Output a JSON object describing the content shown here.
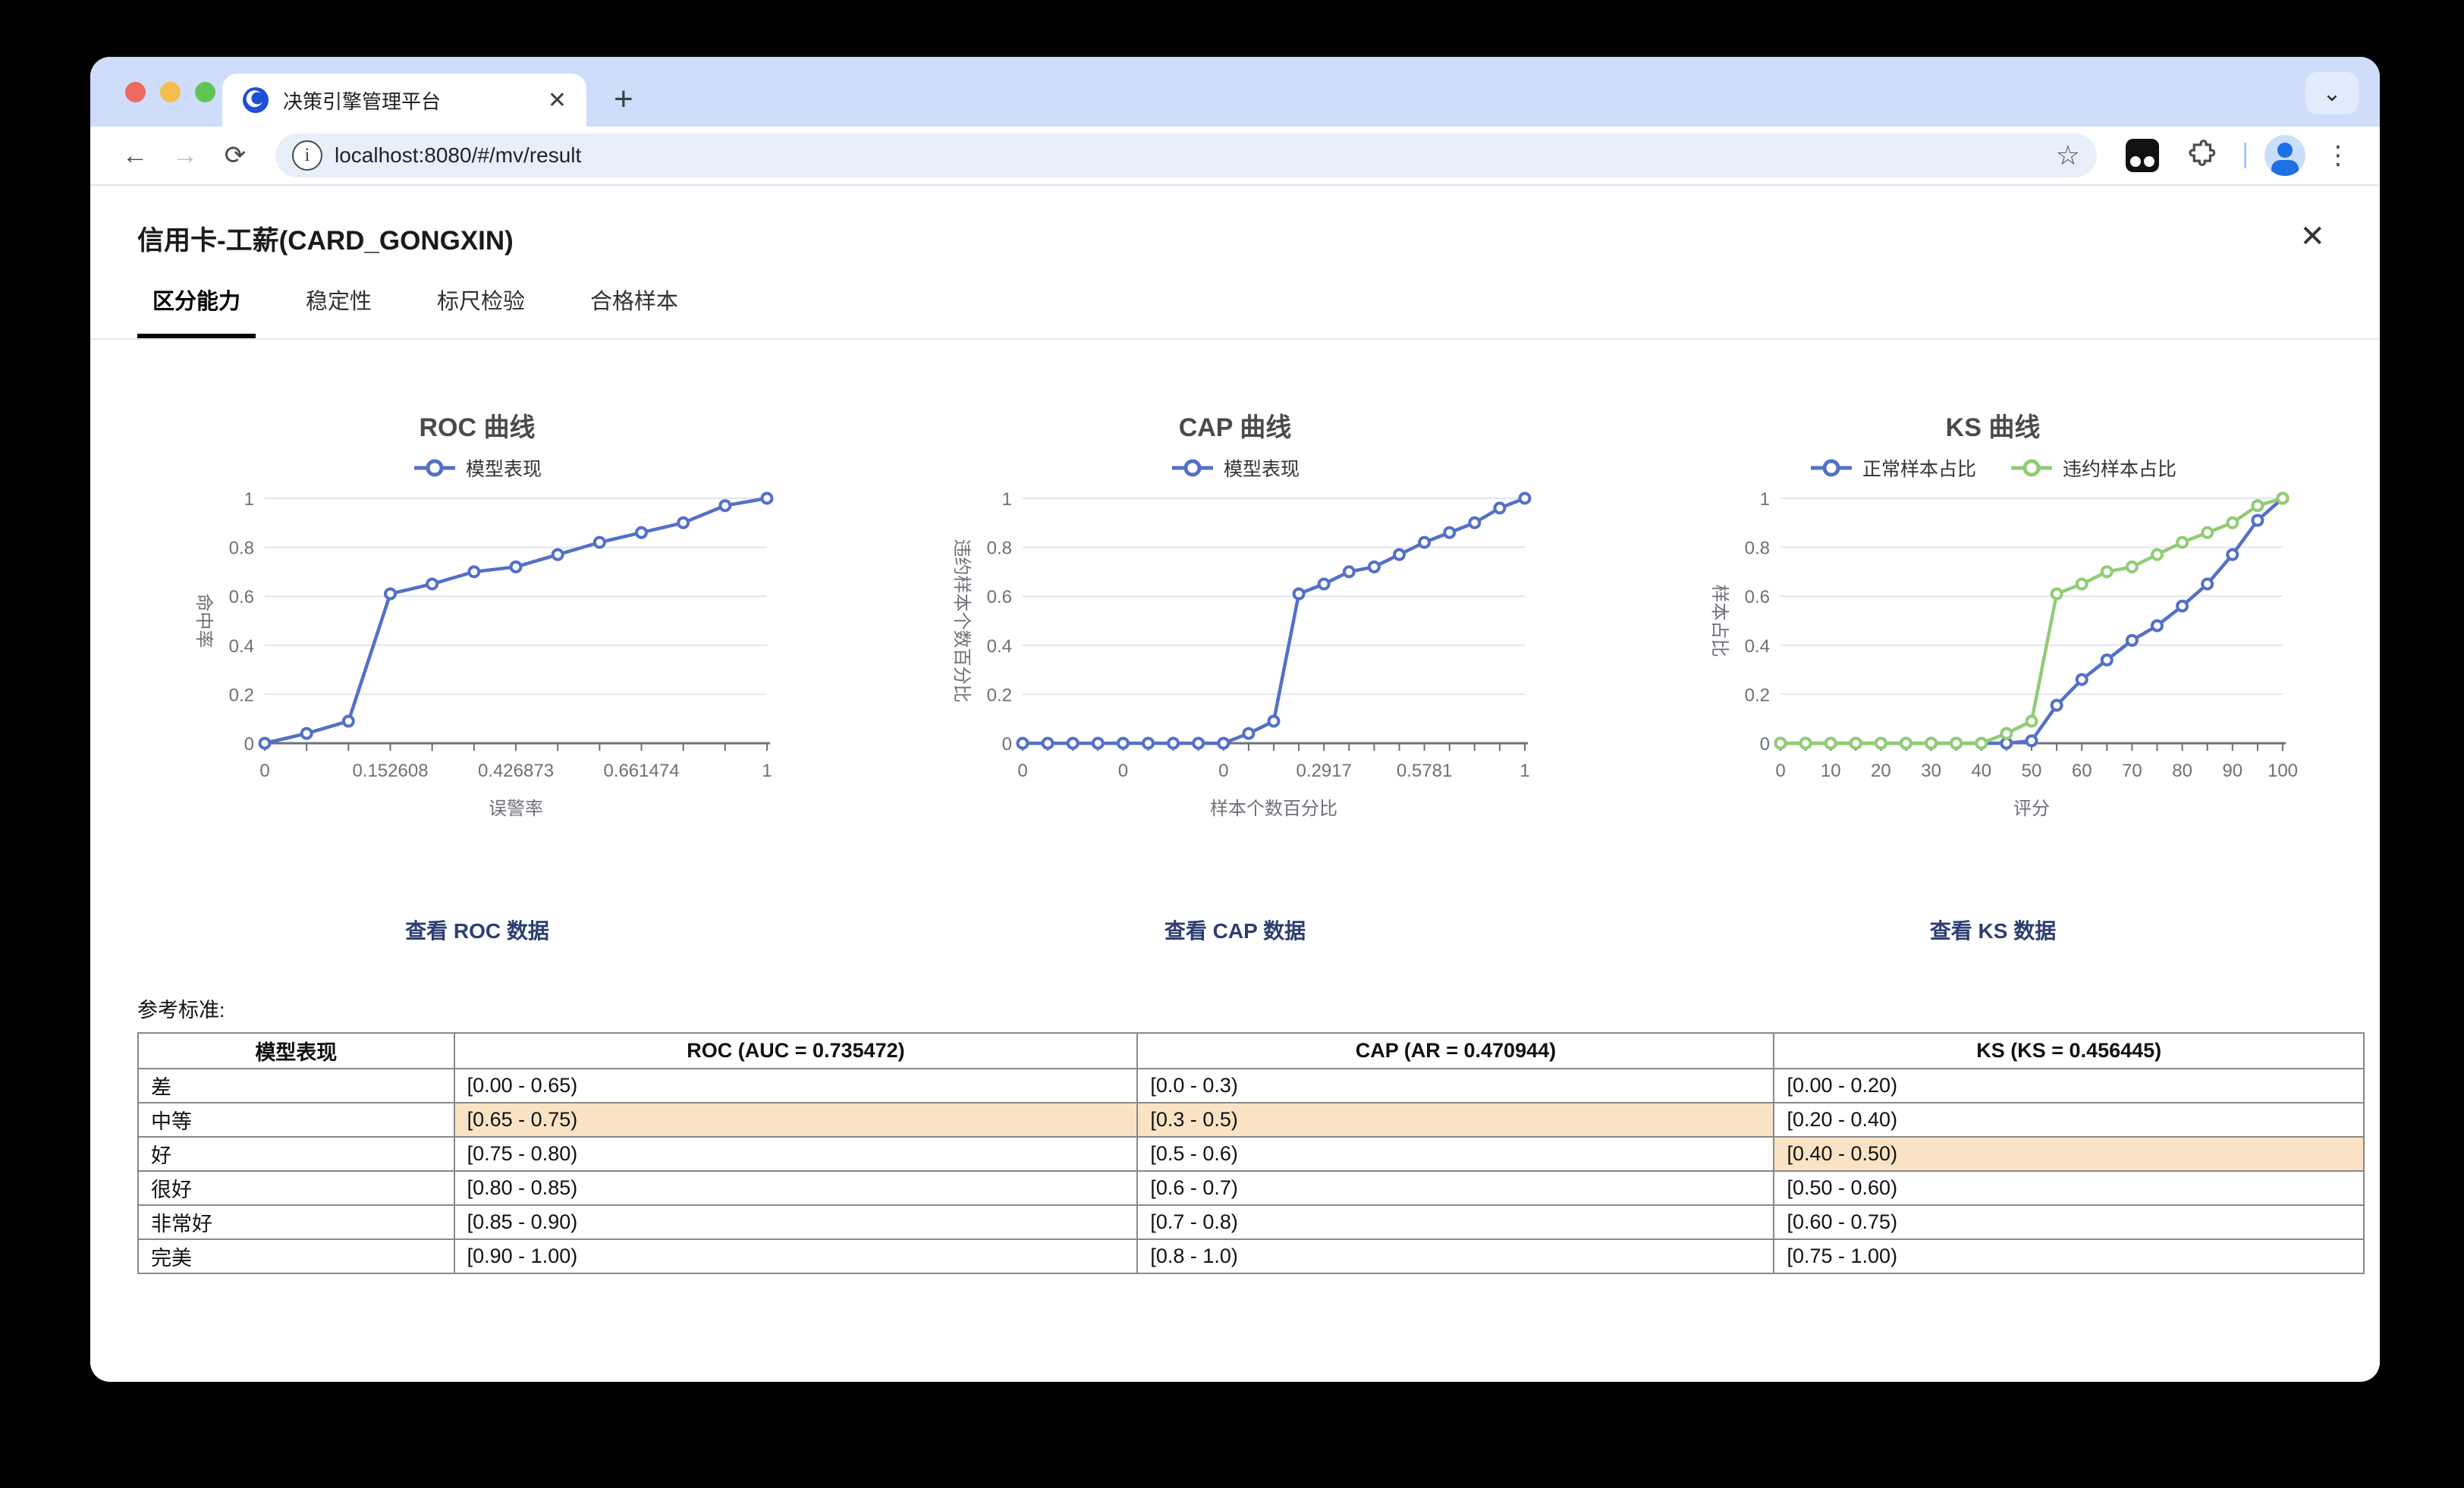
{
  "browser": {
    "tab_title": "决策引擎管理平台",
    "tab_close_icon": "✕",
    "new_tab_icon": "+",
    "strip_chevron_icon": "⌄",
    "back_icon": "←",
    "forward_icon": "→",
    "reload_icon": "⟳",
    "info_icon": "i",
    "url": "localhost:8080/#/mv/result",
    "star_icon": "☆",
    "kebab_icon": "⋮"
  },
  "page": {
    "title": "信用卡-工薪(CARD_GONGXIN)",
    "close_icon": "✕",
    "tabs": [
      {
        "label": "区分能力",
        "active": true
      },
      {
        "label": "稳定性",
        "active": false
      },
      {
        "label": "标尺检验",
        "active": false
      },
      {
        "label": "合格样本",
        "active": false
      }
    ],
    "links": [
      "查看 ROC 数据",
      "查看 CAP 数据",
      "查看 KS 数据"
    ],
    "reference_label": "参考标准:",
    "table": {
      "headers": [
        "模型表现",
        "ROC (AUC = 0.735472)",
        "CAP (AR = 0.470944)",
        "KS (KS = 0.456445)"
      ],
      "rows": [
        {
          "label": "差",
          "roc": "[0.00 - 0.65)",
          "cap": "[0.0 - 0.3)",
          "ks": "[0.00 - 0.20)",
          "highlight": []
        },
        {
          "label": "中等",
          "roc": "[0.65 - 0.75)",
          "cap": "[0.3 - 0.5)",
          "ks": "[0.20 - 0.40)",
          "highlight": [
            "roc",
            "cap"
          ]
        },
        {
          "label": "好",
          "roc": "[0.75 - 0.80)",
          "cap": "[0.5 - 0.6)",
          "ks": "[0.40 - 0.50)",
          "highlight": [
            "ks"
          ]
        },
        {
          "label": "很好",
          "roc": "[0.80 - 0.85)",
          "cap": "[0.6 - 0.7)",
          "ks": "[0.50 - 0.60)",
          "highlight": []
        },
        {
          "label": "非常好",
          "roc": "[0.85 - 0.90)",
          "cap": "[0.7 - 0.8)",
          "ks": "[0.60 - 0.75)",
          "highlight": []
        },
        {
          "label": "完美",
          "roc": "[0.90 - 1.00)",
          "cap": "[0.8 - 1.0)",
          "ks": "[0.75 - 1.00)",
          "highlight": []
        }
      ]
    }
  },
  "chart_data": [
    {
      "type": "line",
      "title": "ROC 曲线",
      "xlabel": "误警率",
      "ylabel": "命中率",
      "ylim": [
        0,
        1
      ],
      "y_ticks": [
        "0",
        "0.2",
        "0.4",
        "0.6",
        "0.8",
        "1"
      ],
      "x_categories": [
        "0",
        "",
        "",
        "0.152608",
        "",
        "",
        "0.426873",
        "",
        "",
        "0.661474",
        "",
        "",
        "1"
      ],
      "series": [
        {
          "name": "模型表现",
          "color": "#5470c6",
          "values": [
            0,
            0.04,
            0.09,
            0.61,
            0.65,
            0.7,
            0.72,
            0.77,
            0.82,
            0.86,
            0.9,
            0.97,
            1
          ]
        }
      ]
    },
    {
      "type": "line",
      "title": "CAP 曲线",
      "xlabel": "样本个数百分比",
      "ylabel": "违约样本个数百分比",
      "ylim": [
        0,
        1
      ],
      "y_ticks": [
        "0",
        "0.2",
        "0.4",
        "0.6",
        "0.8",
        "1"
      ],
      "x_categories": [
        "0",
        "",
        "",
        "",
        "0",
        "",
        "",
        "",
        "0",
        "",
        "",
        "",
        "0.2917",
        "",
        "",
        "",
        "0.5781",
        "",
        "",
        "",
        "1"
      ],
      "series": [
        {
          "name": "模型表现",
          "color": "#5470c6",
          "values": [
            0,
            0,
            0,
            0,
            0,
            0,
            0,
            0,
            0,
            0.04,
            0.09,
            0.61,
            0.65,
            0.7,
            0.72,
            0.77,
            0.82,
            0.86,
            0.9,
            0.96,
            1
          ]
        }
      ]
    },
    {
      "type": "line",
      "title": "KS 曲线",
      "xlabel": "评分",
      "ylabel": "样本占比",
      "ylim": [
        0,
        1
      ],
      "y_ticks": [
        "0",
        "0.2",
        "0.4",
        "0.6",
        "0.8",
        "1"
      ],
      "x_categories": [
        "0",
        "",
        "10",
        "",
        "20",
        "",
        "30",
        "",
        "40",
        "",
        "50",
        "",
        "60",
        "",
        "70",
        "",
        "80",
        "",
        "90",
        "",
        "100"
      ],
      "series": [
        {
          "name": "正常样本占比",
          "color": "#5470c6",
          "values": [
            0,
            0,
            0,
            0,
            0,
            0,
            0,
            0,
            0,
            0,
            0.01,
            0.155,
            0.26,
            0.34,
            0.42,
            0.48,
            0.56,
            0.65,
            0.77,
            0.91,
            1
          ]
        },
        {
          "name": "违约样本占比",
          "color": "#91cc75",
          "values": [
            0,
            0,
            0,
            0,
            0,
            0,
            0,
            0,
            0,
            0.04,
            0.09,
            0.61,
            0.65,
            0.7,
            0.72,
            0.77,
            0.82,
            0.86,
            0.9,
            0.97,
            1
          ]
        }
      ]
    }
  ],
  "colors": {
    "series_blue": "#5470c6",
    "series_green": "#91cc75",
    "grid_line": "#e0e6f1",
    "axis_line": "#6e7079",
    "axis_text": "#6e7079",
    "highlight": "#fae3c5",
    "link": "#2c3e70",
    "tabstrip_bg": "#cfddfb"
  }
}
